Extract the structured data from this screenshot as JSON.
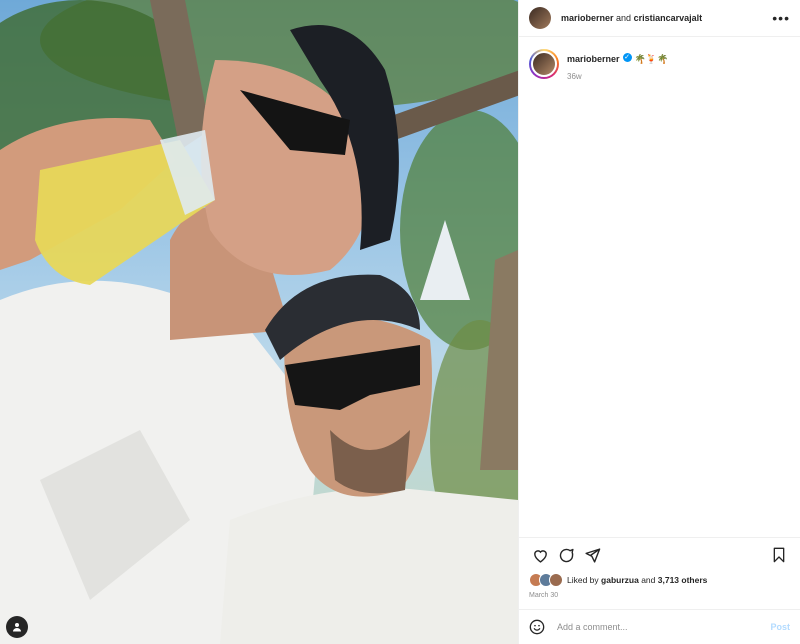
{
  "post": {
    "image_alt": "Selfie of two men in caps and sunglasses under palm trees",
    "header": {
      "author": "marioberner",
      "conjunction": "and",
      "collaborator": "cristiancarvajalt"
    },
    "caption": {
      "username": "marioberner",
      "emojis": "🌴🍹🌴",
      "age": "36w"
    },
    "likes": {
      "prefix": "Liked by",
      "user": "gaburzua",
      "joiner": "and",
      "count": "3,713 others"
    },
    "date": "March 30",
    "comment": {
      "placeholder": "Add a comment...",
      "post_label": "Post"
    }
  },
  "icons": [
    "more-options-icon",
    "verified-icon",
    "heart-icon",
    "comment-icon",
    "share-icon",
    "bookmark-icon",
    "emoji-icon",
    "user-tag-icon"
  ],
  "colors": {
    "accent": "#0095f6",
    "post_disabled": "#b3dbff",
    "muted": "#8e8e8e",
    "border": "#efefef"
  }
}
